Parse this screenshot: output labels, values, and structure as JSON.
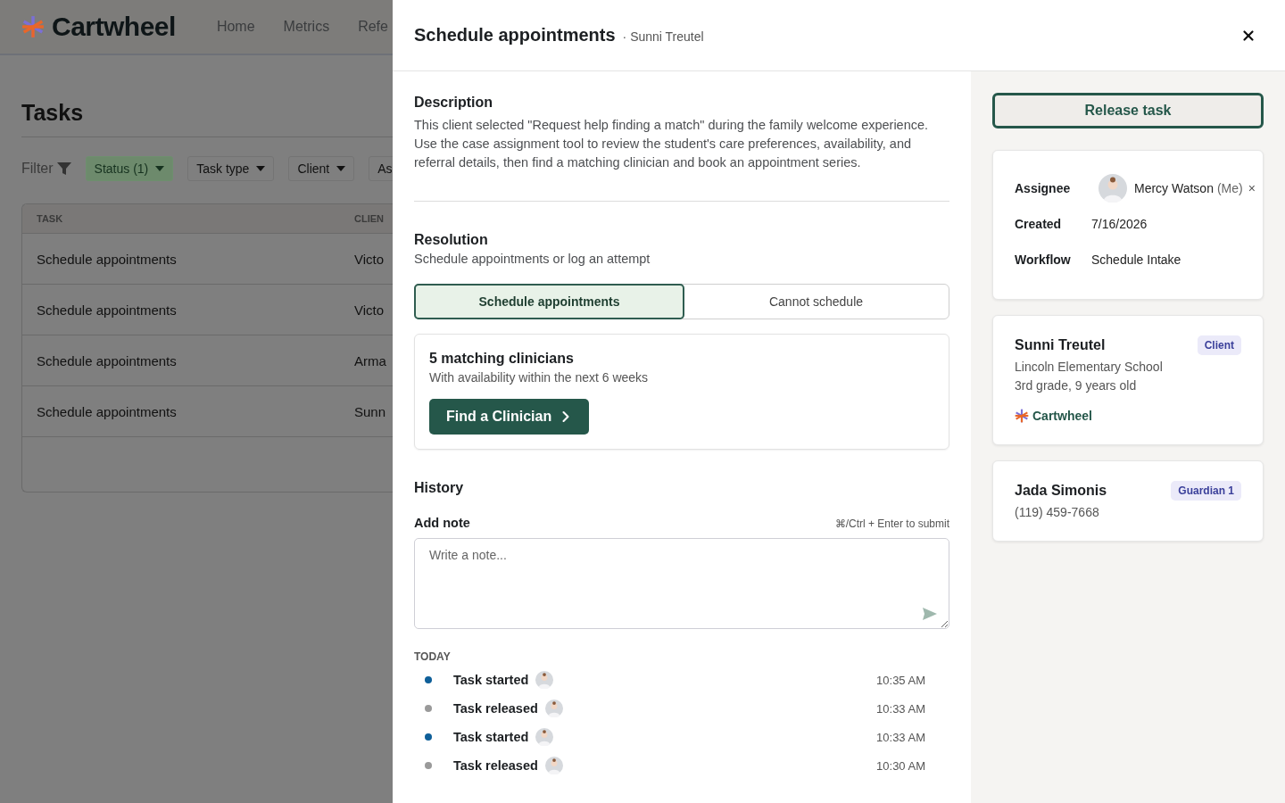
{
  "nav": {
    "logo": "Cartwheel",
    "links": [
      "Home",
      "Metrics",
      "Refe"
    ]
  },
  "page": {
    "title": "Tasks",
    "filter_label": "Filter",
    "filters": [
      {
        "label": "Status (1)",
        "active": true,
        "caret": true
      },
      {
        "label": "Task type",
        "active": false,
        "caret": true
      },
      {
        "label": "Client",
        "active": false,
        "caret": true
      },
      {
        "label": "As",
        "active": false,
        "caret": false
      }
    ],
    "table": {
      "columns": [
        "TASK",
        "CLIEN"
      ],
      "rows": [
        [
          "Schedule appointments",
          "Victo"
        ],
        [
          "Schedule appointments",
          "Victo"
        ],
        [
          "Schedule appointments",
          "Arma"
        ],
        [
          "Schedule appointments",
          "Sunn"
        ]
      ]
    }
  },
  "drawer": {
    "title": "Schedule appointments",
    "subtitle": "· Sunni Treutel",
    "description": {
      "heading": "Description",
      "text": "This client selected \"Request help finding a match\" during the family welcome experience. Use the case assignment tool to review the student's care preferences, availability, and referral details, then find a matching clinician and book an appointment series."
    },
    "resolution": {
      "heading": "Resolution",
      "subtext": "Schedule appointments or log an attempt",
      "options": [
        {
          "label": "Schedule appointments",
          "selected": true
        },
        {
          "label": "Cannot schedule",
          "selected": false
        }
      ],
      "card": {
        "title": "5 matching clinicians",
        "subtitle": "With availability within the next 6 weeks",
        "button": "Find a Clinician"
      }
    },
    "history": {
      "heading": "History",
      "note_label": "Add note",
      "hint": "⌘/Ctrl + Enter to submit",
      "placeholder": "Write a note...",
      "group": "TODAY",
      "events": [
        {
          "label": "Task started",
          "time": "10:35 AM",
          "color": "#0f5f99"
        },
        {
          "label": "Task released",
          "time": "10:33 AM",
          "color": "#9a9a9a"
        },
        {
          "label": "Task started",
          "time": "10:33 AM",
          "color": "#0f5f99"
        },
        {
          "label": "Task released",
          "time": "10:30 AM",
          "color": "#9a9a9a"
        }
      ]
    },
    "side": {
      "release_button": "Release task",
      "details": [
        {
          "kind": "person",
          "label": "Assignee",
          "value": "Mercy Watson",
          "note": "(Me)",
          "remove": "×"
        },
        {
          "kind": "text",
          "label": "Created",
          "value": "7/16/2026"
        },
        {
          "kind": "text",
          "label": "Workflow",
          "value": "Schedule Intake"
        }
      ],
      "contacts": [
        {
          "name": "Sunni Treutel",
          "badge": "Client",
          "lines": [
            "Lincoln Elementary School",
            "3rd grade, 9 years old"
          ],
          "brand": "Cartwheel"
        },
        {
          "name": "Jada Simonis",
          "badge": "Guardian 1",
          "lines": [
            "(119) 459-7668"
          ]
        }
      ]
    }
  }
}
